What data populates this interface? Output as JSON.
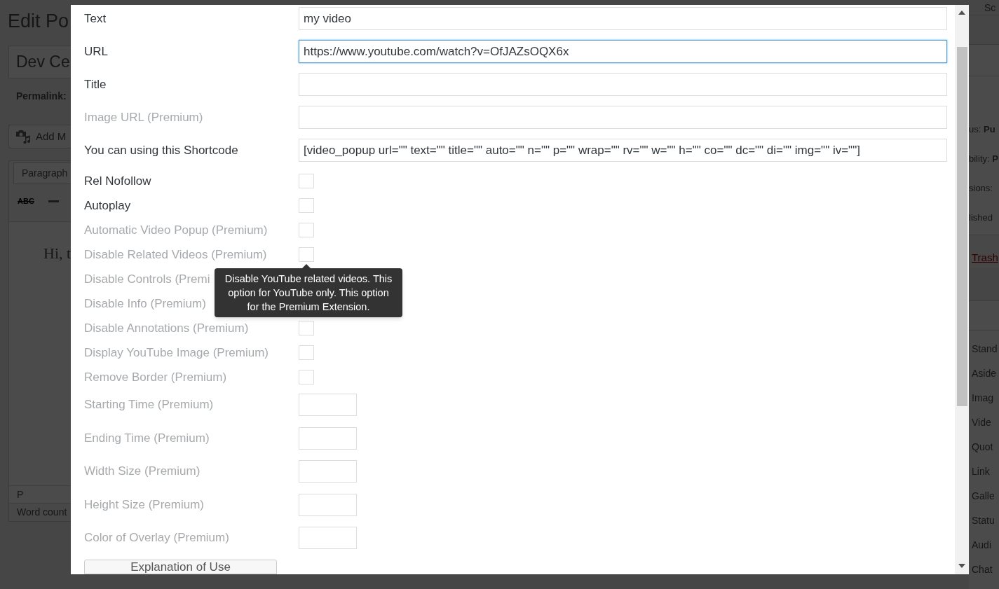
{
  "background": {
    "page_heading": "Edit Po",
    "post_title": "Dev Ce",
    "permalink_label": "Permalink:",
    "add_media_button": "Add M",
    "editor": {
      "format_select": "Paragraph",
      "strikethrough_button": "ABC",
      "content": "Hi, t",
      "path": "P",
      "word_count": "Word count"
    },
    "screen_options_tab": "Sc",
    "publish_box": {
      "rows": [
        "us: **Pu**",
        "bility: **P**",
        "sions:",
        "lished"
      ],
      "trash_link": "Trash"
    },
    "format_box": {
      "items": [
        "Stand",
        "Aside",
        "Imag",
        "Vide",
        "Quot",
        "Link",
        "Galle",
        "Statu",
        "Audi",
        "Chat"
      ]
    }
  },
  "modal": {
    "fields": [
      {
        "kind": "text",
        "label": "Text",
        "value": "my video",
        "disabled": false,
        "focused": false
      },
      {
        "kind": "text",
        "label": "URL",
        "value": "https://www.youtube.com/watch?v=OfJAZsOQX6x",
        "disabled": false,
        "focused": true
      },
      {
        "kind": "text",
        "label": "Title",
        "disabled": false,
        "focused": false
      },
      {
        "kind": "text",
        "label": "Image URL (Premium)",
        "disabled": true,
        "focused": false
      },
      {
        "kind": "text",
        "label": "You can using this Shortcode",
        "value": "[video_popup url=\"\" text=\"\" title=\"\" auto=\"\" n=\"\" p=\"\" wrap=\"\" rv=\"\" w=\"\" h=\"\" co=\"\" dc=\"\" di=\"\" img=\"\" iv=\"\"]",
        "disabled": false,
        "focused": false
      },
      {
        "kind": "checkbox",
        "label": "Rel Nofollow",
        "checked": false,
        "disabled": false,
        "focused": false
      },
      {
        "kind": "checkbox",
        "label": "Autoplay",
        "checked": false,
        "disabled": false,
        "focused": false
      },
      {
        "kind": "checkbox",
        "label": "Automatic Video Popup (Premium)",
        "checked": false,
        "disabled": true,
        "focused": false
      },
      {
        "kind": "checkbox",
        "label": "Disable Related Videos (Premium)",
        "checked": false,
        "disabled": true,
        "focused": false,
        "tooltip": "Disable YouTube related videos. This option for YouTube only. This option for the Premium Extension."
      },
      {
        "kind": "checkbox",
        "label": "Disable Controls (Premi",
        "disabled": true
      },
      {
        "kind": "checkbox",
        "label": "Disable Info (Premium)",
        "disabled": true
      },
      {
        "kind": "checkbox",
        "label": "Disable Annotations (Premium)",
        "checked": false,
        "disabled": true,
        "focused": false
      },
      {
        "kind": "checkbox",
        "label": "Display YouTube Image (Premium)",
        "checked": false,
        "disabled": true,
        "focused": false
      },
      {
        "kind": "checkbox",
        "label": "Remove Border (Premium)",
        "checked": false,
        "disabled": true,
        "focused": false
      },
      {
        "kind": "small",
        "label": "Starting Time (Premium)",
        "disabled": true,
        "focused": false
      },
      {
        "kind": "small",
        "label": "Ending Time (Premium)",
        "disabled": true,
        "focused": false
      },
      {
        "kind": "small",
        "label": "Width Size (Premium)",
        "disabled": true,
        "focused": false
      },
      {
        "kind": "small",
        "label": "Height Size (Premium)",
        "disabled": true,
        "focused": false
      },
      {
        "kind": "small",
        "label": "Color of Overlay (Premium)",
        "disabled": true,
        "focused": false
      }
    ],
    "button": "Explanation of Use"
  }
}
